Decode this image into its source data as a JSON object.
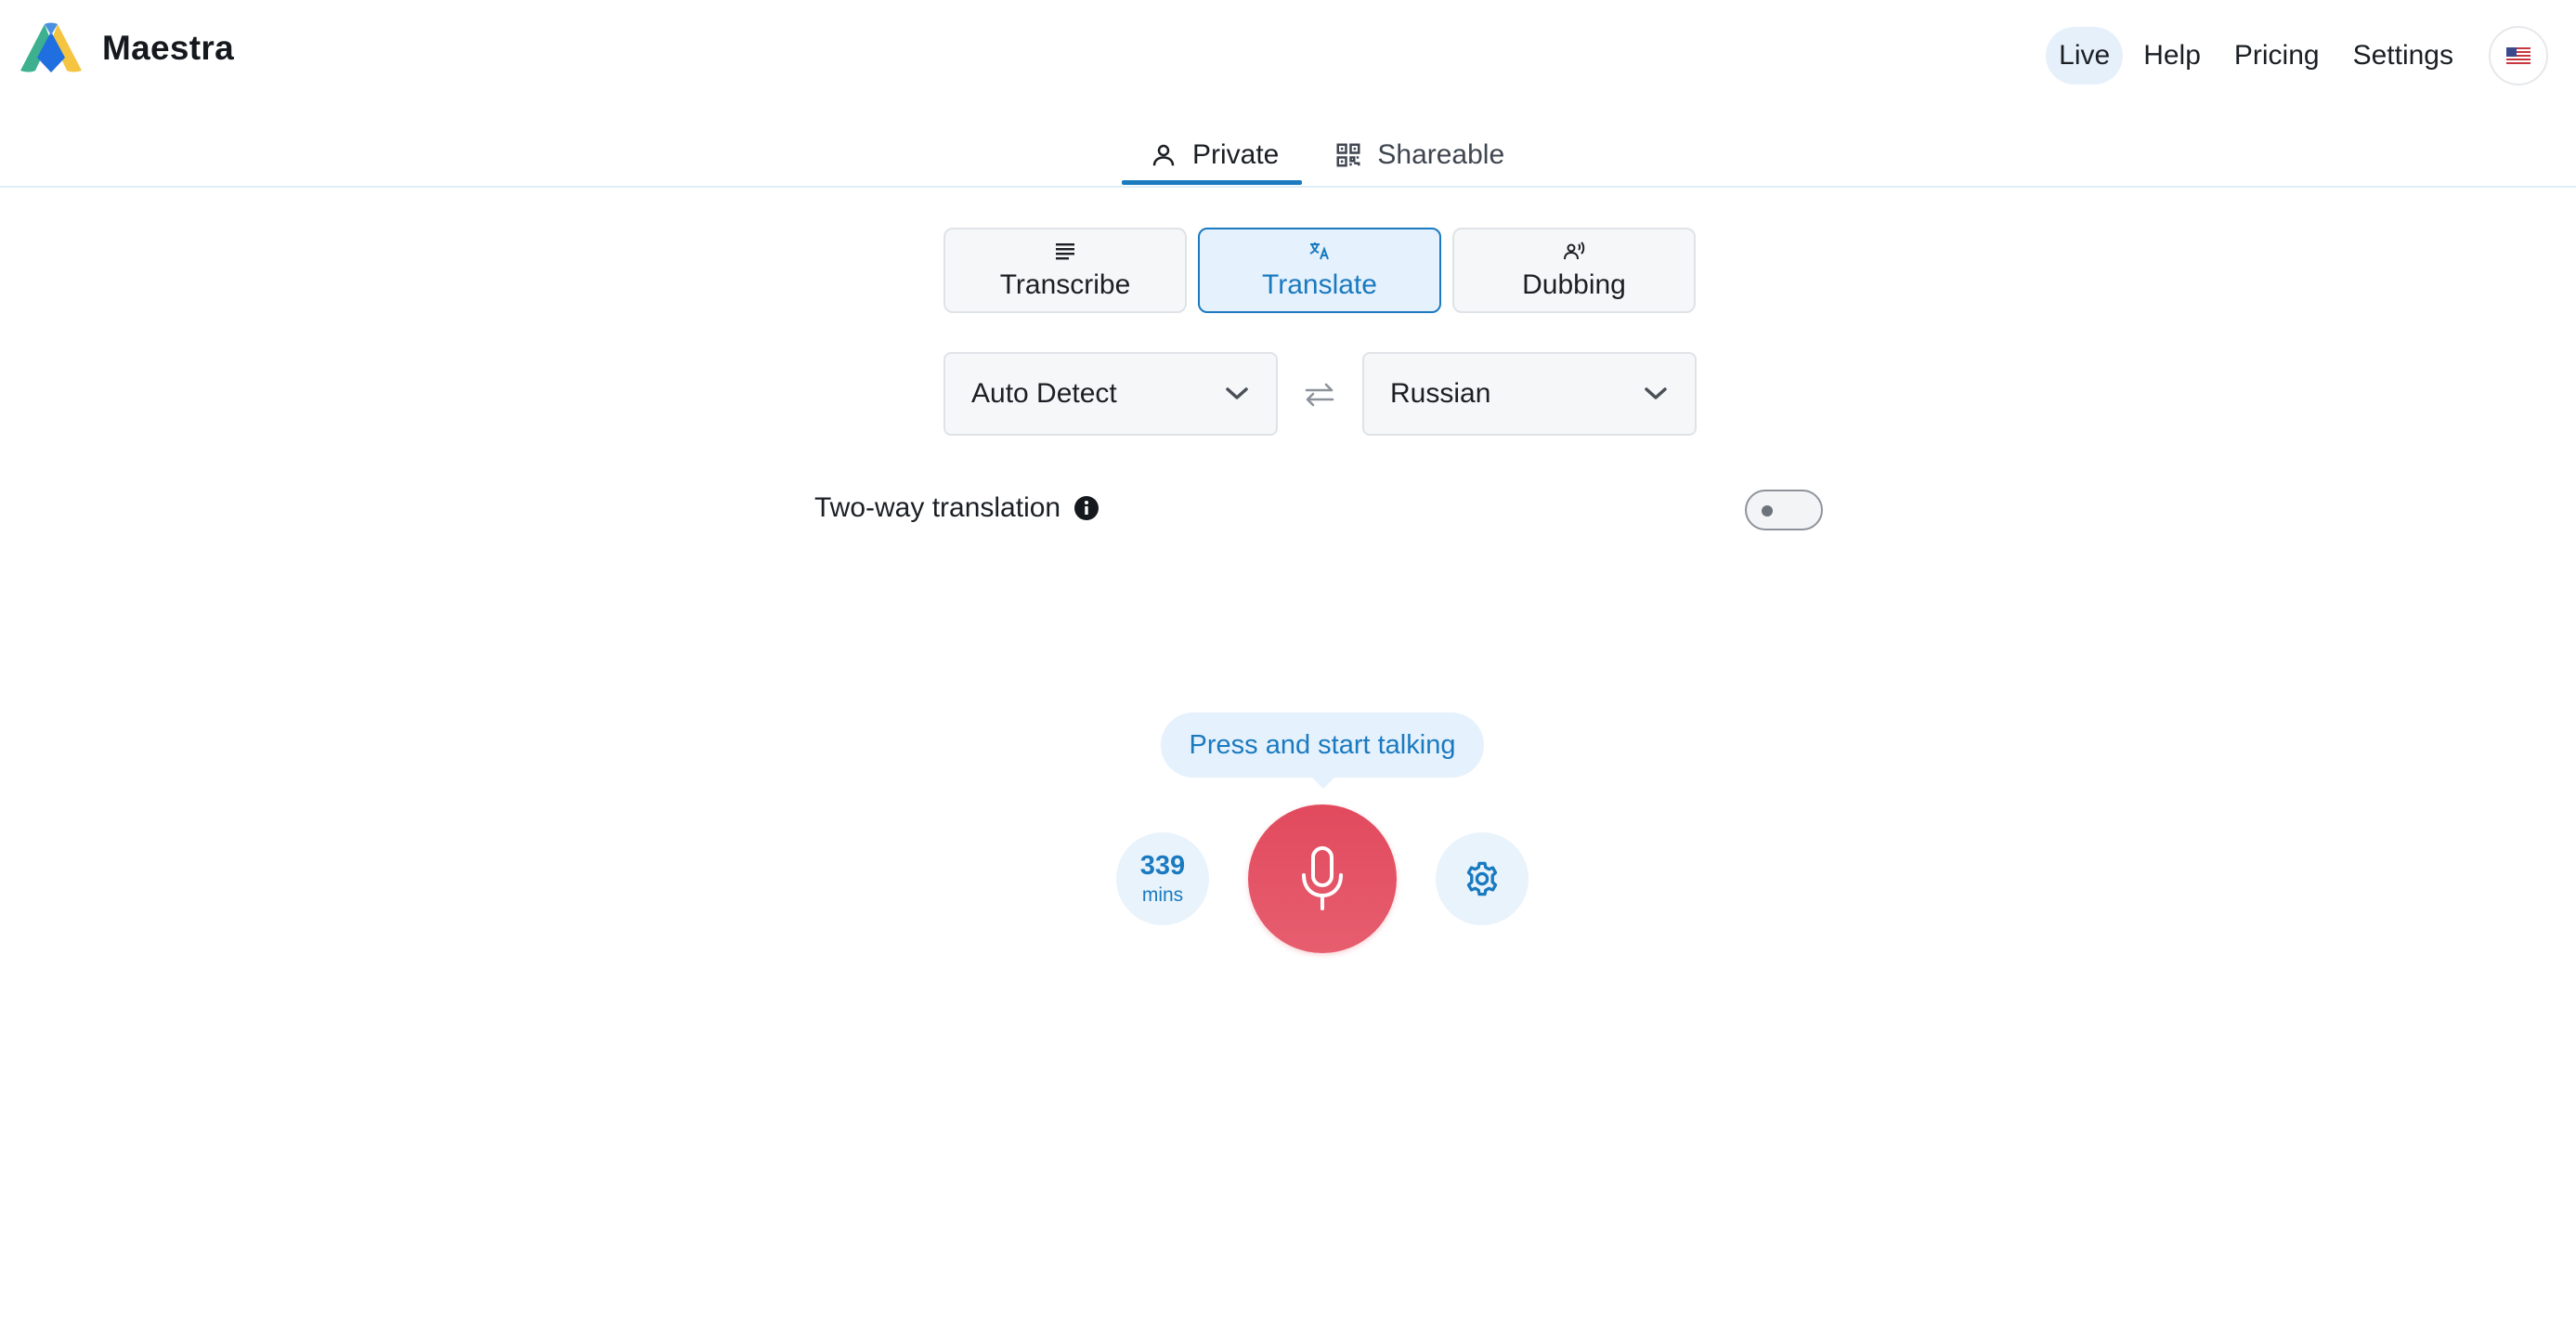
{
  "header": {
    "brand": "Maestra",
    "logo_icon": "maestra-logo-icon",
    "nav": [
      {
        "label": "Live",
        "active": true
      },
      {
        "label": "Help",
        "active": false
      },
      {
        "label": "Pricing",
        "active": false
      },
      {
        "label": "Settings",
        "active": false
      }
    ],
    "language_icon": "us-flag-icon"
  },
  "mode_tabs": [
    {
      "label": "Private",
      "icon": "person-icon",
      "active": true
    },
    {
      "label": "Shareable",
      "icon": "qr-code-icon",
      "active": false
    }
  ],
  "functions": [
    {
      "label": "Transcribe",
      "icon": "lines-icon",
      "active": false
    },
    {
      "label": "Translate",
      "icon": "translate-icon",
      "active": true
    },
    {
      "label": "Dubbing",
      "icon": "voice-person-icon",
      "active": false
    }
  ],
  "source_language": "Auto Detect",
  "target_language": "Russian",
  "two_way": {
    "label": "Two-way translation",
    "enabled": false
  },
  "tooltip": "Press and start talking",
  "minutes": {
    "value": "339",
    "unit": "mins"
  },
  "colors": {
    "accent": "#1a7ac0",
    "accent_light": "#e5f1fc",
    "mic": "#e24a5e"
  }
}
